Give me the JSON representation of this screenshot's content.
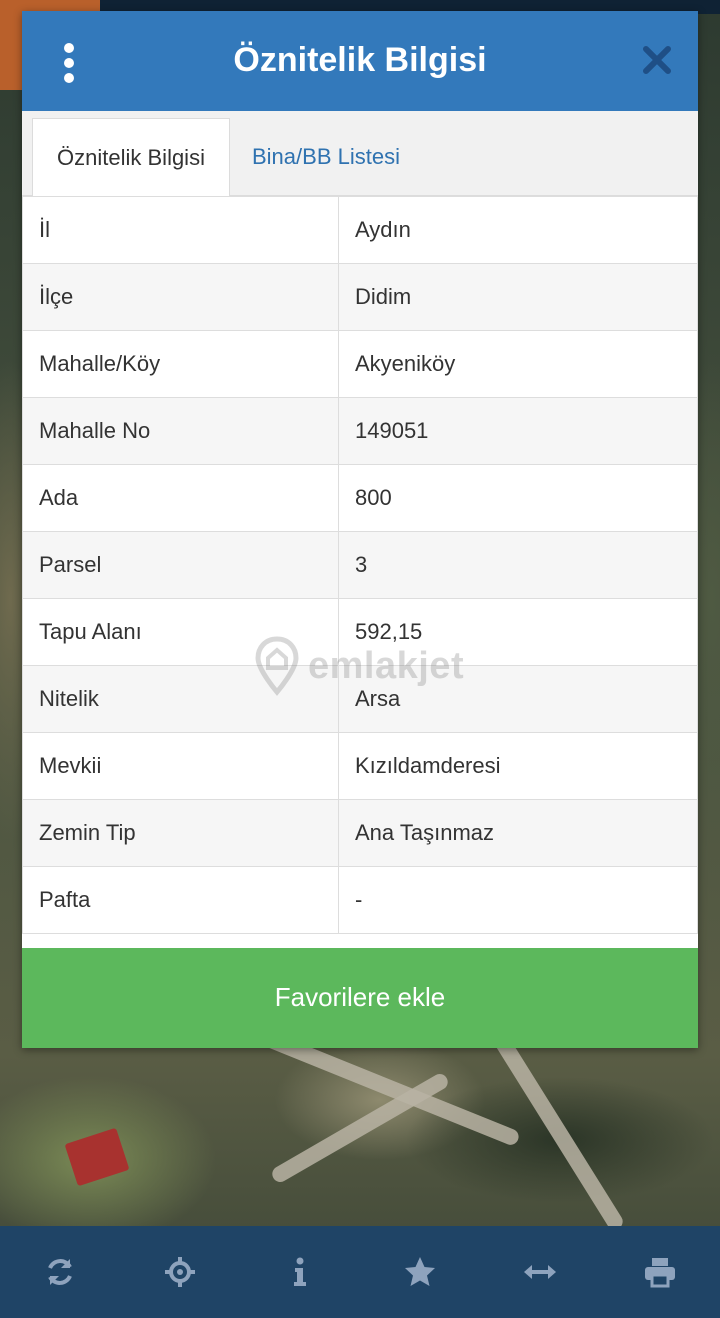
{
  "header": {
    "title": "Öznitelik Bilgisi"
  },
  "tabs": [
    {
      "label": "Öznitelik Bilgisi",
      "active": true
    },
    {
      "label": "Bina/BB Listesi",
      "active": false
    }
  ],
  "attributes": [
    {
      "key": "İl",
      "value": "Aydın"
    },
    {
      "key": "İlçe",
      "value": "Didim"
    },
    {
      "key": "Mahalle/Köy",
      "value": "Akyeniköy"
    },
    {
      "key": "Mahalle No",
      "value": "149051"
    },
    {
      "key": "Ada",
      "value": "800"
    },
    {
      "key": "Parsel",
      "value": "3"
    },
    {
      "key": "Tapu Alanı",
      "value": "592,15"
    },
    {
      "key": "Nitelik",
      "value": "Arsa"
    },
    {
      "key": "Mevkii",
      "value": "Kızıldamderesi"
    },
    {
      "key": "Zemin Tip",
      "value": "Ana Taşınmaz"
    },
    {
      "key": "Pafta",
      "value": "-"
    }
  ],
  "favorite_button": {
    "label": "Favorilere ekle"
  },
  "watermark": {
    "text": "emlakjet"
  },
  "toolbar": [
    {
      "icon": "refresh-icon"
    },
    {
      "icon": "crosshair-icon"
    },
    {
      "icon": "info-icon"
    },
    {
      "icon": "star-icon"
    },
    {
      "icon": "horizontal-arrows-icon"
    },
    {
      "icon": "printer-icon"
    }
  ],
  "colors": {
    "header": "#3379bb",
    "button": "#5cb85c",
    "toolbar": "#1f4466",
    "tab_link": "#2f72b0"
  }
}
